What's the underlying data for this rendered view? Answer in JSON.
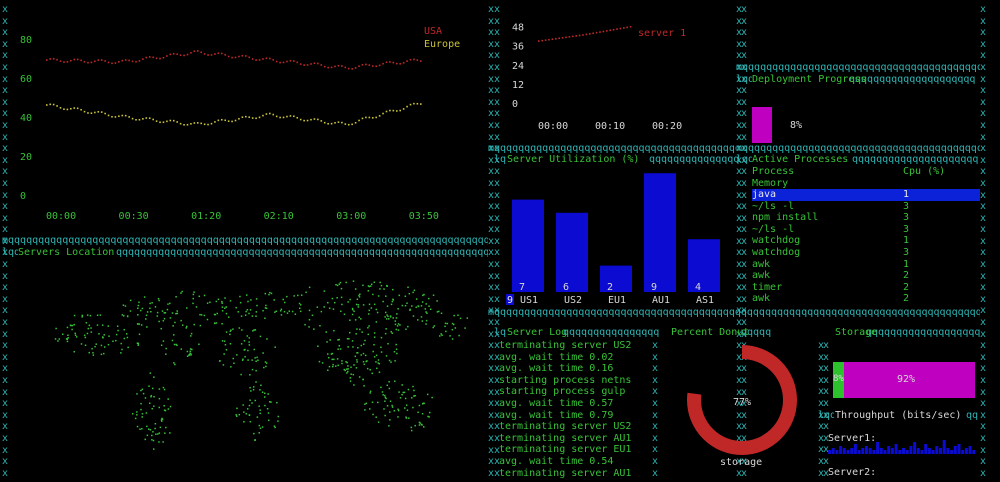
{
  "colors": {
    "frame": "#2fb5b5",
    "text": "#38c238",
    "usa": "#c02828",
    "europe": "#c9c33a",
    "bar": "#0b0bd2",
    "gauge": "#c000c0",
    "donut": "#c02828",
    "selected": "#0b22d8"
  },
  "line_chart": {
    "legend": [
      "USA",
      "Europe"
    ],
    "y_ticks": [
      "80",
      "60",
      "40",
      "20",
      "0"
    ],
    "x_ticks": [
      "00:00",
      "00:30",
      "01:20",
      "02:10",
      "03:00",
      "03:50"
    ]
  },
  "chart_data": [
    {
      "type": "line",
      "title": "",
      "x": [
        "00:00",
        "00:30",
        "01:20",
        "02:10",
        "03:00",
        "03:50"
      ],
      "series": [
        {
          "name": "USA",
          "values": [
            70,
            69,
            74,
            70,
            66,
            70
          ]
        },
        {
          "name": "Europe",
          "values": [
            47,
            41,
            37,
            42,
            37,
            48
          ]
        }
      ],
      "ylim": [
        0,
        85
      ]
    },
    {
      "type": "line",
      "title": "",
      "x": [
        "00:00",
        "00:10",
        "00:20"
      ],
      "series": [
        {
          "name": "server 1",
          "values": [
            40,
            44,
            49
          ]
        }
      ]
    },
    {
      "type": "bar",
      "title": "Server Utilization (%)",
      "categories": [
        "US1",
        "US2",
        "EU1",
        "AU1",
        "AS1"
      ],
      "values": [
        7,
        6,
        2,
        9,
        4
      ]
    }
  ],
  "server_line": {
    "legend": "server 1",
    "y_ticks": [
      "48",
      "36",
      "24",
      "12",
      "0"
    ],
    "x_ticks": [
      "00:00",
      "00:10",
      "00:20"
    ]
  },
  "deployment": {
    "title": "Deployment Progress",
    "percent_label": "8%",
    "progress": 0.08
  },
  "utilization": {
    "title": "Server Utilization (%)",
    "categories": [
      "US1",
      "US2",
      "EU1",
      "AU1",
      "AS1"
    ],
    "values": [
      7,
      6,
      2,
      9,
      4
    ],
    "first_badge": "9"
  },
  "processes": {
    "title": "Active Processes",
    "headers": [
      "Process",
      "Cpu (%)",
      "Memory"
    ],
    "rows": [
      {
        "name": "java",
        "cpu": "1"
      },
      {
        "name": "~/ls -l",
        "cpu": "3"
      },
      {
        "name": "npm install",
        "cpu": "3"
      },
      {
        "name": "~/ls -l",
        "cpu": "3"
      },
      {
        "name": "watchdog",
        "cpu": "1"
      },
      {
        "name": "watchdog",
        "cpu": "3"
      },
      {
        "name": "awk",
        "cpu": "1"
      },
      {
        "name": "awk",
        "cpu": "2"
      },
      {
        "name": "timer",
        "cpu": "2"
      },
      {
        "name": "awk",
        "cpu": "2"
      }
    ]
  },
  "map": {
    "title": "Servers Location"
  },
  "log": {
    "title": "Server Log",
    "lines": [
      "terminating server US2",
      "avg. wait time 0.02",
      "avg. wait time 0.16",
      "starting process netns",
      "starting process gulp",
      "avg. wait time 0.57",
      "avg. wait time 0.79",
      "terminating server US2",
      "terminating server AU1",
      "terminating server EU1",
      "avg. wait time 0.54",
      "terminating server AU1"
    ]
  },
  "donut": {
    "title": "Percent Donut",
    "value_label": "77%",
    "caption": "storage",
    "value": 0.77
  },
  "storage": {
    "title": "Storage",
    "percent_label": "92%",
    "percent": 0.92,
    "used_label": "8%"
  },
  "throughput": {
    "title": "Throughput (bits/sec)",
    "label1": "Server1:",
    "label2": "Server2:"
  }
}
